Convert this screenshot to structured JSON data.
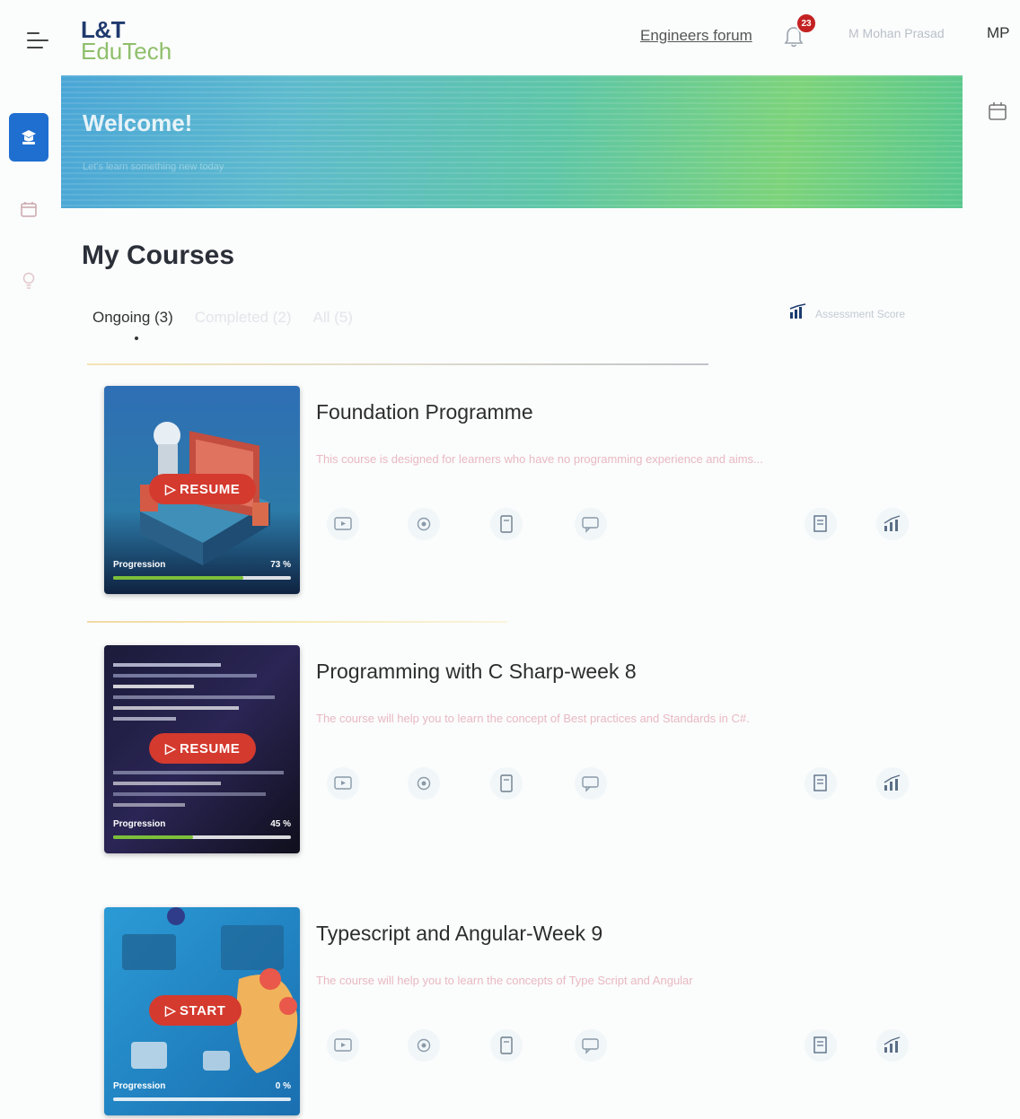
{
  "header": {
    "logo_top": "L&T",
    "logo_bottom": "EduTech",
    "forum_link": "Engineers forum",
    "notification_count": "23",
    "user_name": "M Mohan Prasad",
    "user_initials": "MP"
  },
  "banner": {
    "title": "Welcome!",
    "subtitle": "Let's learn something new today"
  },
  "my_courses": {
    "title": "My Courses",
    "tabs": [
      {
        "label": "Ongoing (3)",
        "active": true
      },
      {
        "label": "Completed (2)",
        "active": false
      },
      {
        "label": "All (5)",
        "active": false
      }
    ],
    "assessment_label": "Assessment Score"
  },
  "courses": [
    {
      "title": "Foundation Programme",
      "description": "This course is designed for learners who have no programming experience and aims...",
      "button": "RESUME",
      "progress_label": "Progression",
      "progress_text": "73 %",
      "progress": 0.73
    },
    {
      "title": "Programming with C Sharp-week 8",
      "description": "The course will help you to learn the concept of Best practices and Standards in C#.",
      "button": "RESUME",
      "progress_label": "Progression",
      "progress_text": "45 %",
      "progress": 0.45
    },
    {
      "title": "Typescript and Angular-Week 9",
      "description": "The course will help you to learn the concepts of Type Script and Angular",
      "button": "START",
      "progress_label": "Progression",
      "progress_text": "0 %",
      "progress": 0
    }
  ],
  "icons": {
    "menu": "hamburger-menu-icon",
    "notification": "bell-icon",
    "rail": [
      "courses-icon",
      "calendar-icon",
      "lightbulb-icon"
    ],
    "course_actions": [
      "video-icon",
      "settings-icon",
      "document-icon",
      "chat-icon",
      "notes-icon",
      "analytics-icon"
    ]
  },
  "colors": {
    "accent_blue": "#1f6fd0",
    "button_red": "#d43a2e",
    "progress_green": "#7cbf3a",
    "badge_red": "#c42222"
  }
}
